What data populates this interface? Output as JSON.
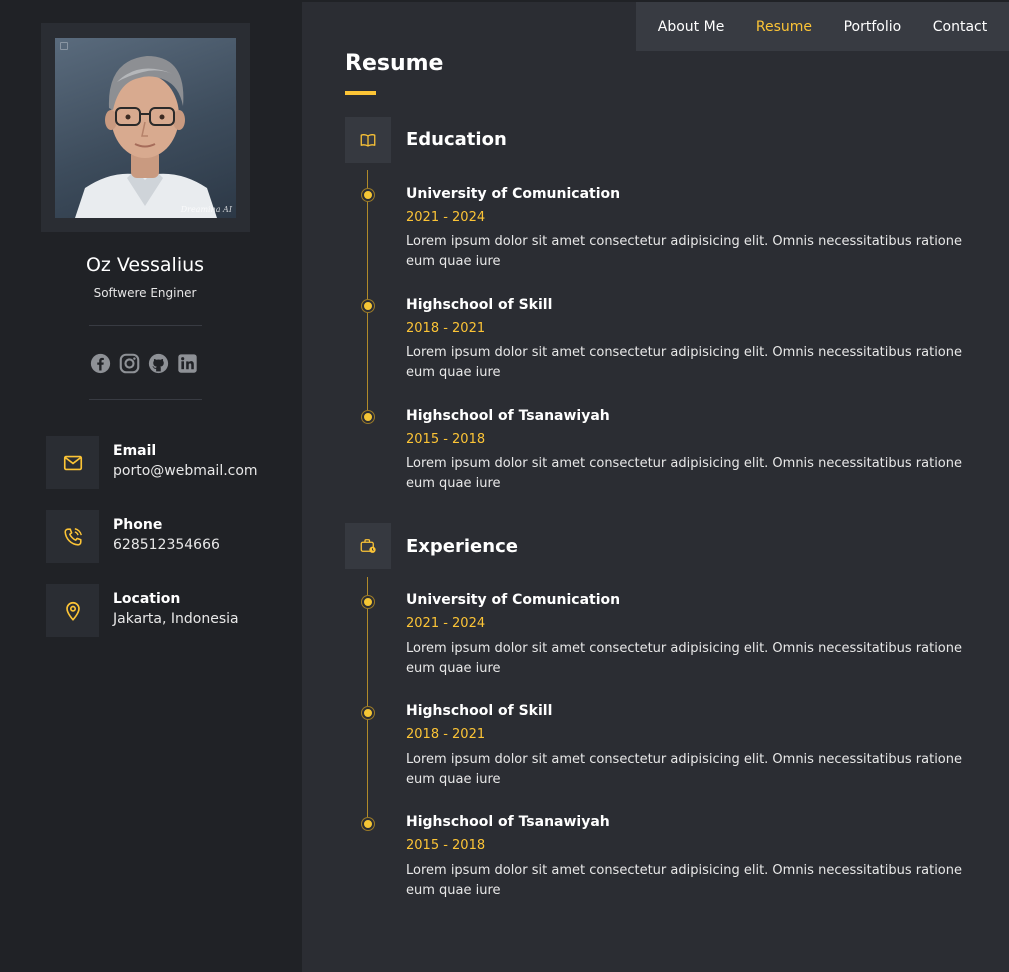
{
  "profile": {
    "name": "Oz Vessalius",
    "role": "Softwere Enginer",
    "avatar_icon": "portrait-photo",
    "watermark": "Dreamina AI"
  },
  "socials": [
    {
      "icon": "facebook-icon"
    },
    {
      "icon": "instagram-icon"
    },
    {
      "icon": "github-icon"
    },
    {
      "icon": "linkedin-icon"
    }
  ],
  "contacts": [
    {
      "label": "Email",
      "value": "porto@webmail.com",
      "icon": "mail-icon"
    },
    {
      "label": "Phone",
      "value": "628512354666",
      "icon": "phone-icon"
    },
    {
      "label": "Location",
      "value": "Jakarta, Indonesia",
      "icon": "location-pin-icon"
    }
  ],
  "nav": {
    "items": [
      "About Me",
      "Resume",
      "Portfolio",
      "Contact"
    ],
    "active": "Resume"
  },
  "resume": {
    "title": "Resume",
    "education": {
      "title": "Education",
      "icon": "book-icon",
      "entries": [
        {
          "title": "University of Comunication",
          "years": "2021 - 2024",
          "desc": "Lorem ipsum dolor sit amet consectetur adipisicing elit. Omnis necessitatibus ratione eum quae iure"
        },
        {
          "title": "Highschool of Skill",
          "years": "2018 - 2021",
          "desc": "Lorem ipsum dolor sit amet consectetur adipisicing elit. Omnis necessitatibus ratione eum quae iure"
        },
        {
          "title": "Highschool of Tsanawiyah",
          "years": "2015 - 2018",
          "desc": "Lorem ipsum dolor sit amet consectetur adipisicing elit. Omnis necessitatibus ratione eum quae iure"
        }
      ]
    },
    "experience": {
      "title": "Experience",
      "icon": "briefcase-clock-icon",
      "entries": [
        {
          "title": "University of Comunication",
          "years": "2021 - 2024",
          "desc": "Lorem ipsum dolor sit amet consectetur adipisicing elit. Omnis necessitatibus ratione eum quae iure"
        },
        {
          "title": "Highschool of Skill",
          "years": "2018 - 2021",
          "desc": "Lorem ipsum dolor sit amet consectetur adipisicing elit. Omnis necessitatibus ratione eum quae iure"
        },
        {
          "title": "Highschool of Tsanawiyah",
          "years": "2015 - 2018",
          "desc": "Lorem ipsum dolor sit amet consectetur adipisicing elit. Omnis necessitatibus ratione eum quae iure"
        }
      ]
    }
  },
  "colors": {
    "accent": "#fcc436",
    "sidebar_bg": "#202226",
    "main_bg": "#2b2d33",
    "nav_bg": "#383b42"
  }
}
